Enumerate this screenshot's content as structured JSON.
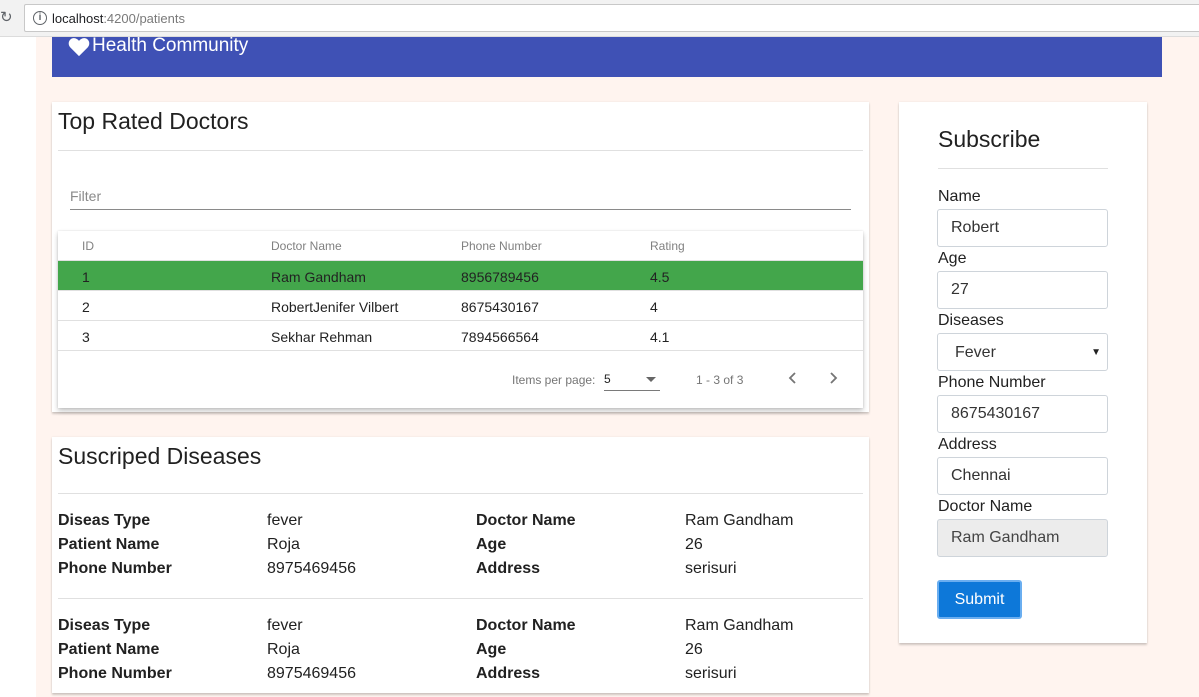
{
  "browser": {
    "url_host": "localhost",
    "url_rest": ":4200/patients"
  },
  "app": {
    "title": "Health Community",
    "brand_color": "#3f51b5",
    "icon": "heart-icon"
  },
  "doctors": {
    "title": "Top Rated Doctors",
    "filter_placeholder": "Filter",
    "columns": {
      "id": "ID",
      "name": "Doctor Name",
      "phone": "Phone Number",
      "rating": "Rating"
    },
    "rows": [
      {
        "id": "1",
        "name": "Ram Gandham",
        "phone": "8956789456",
        "rating": "4.5",
        "selected": true
      },
      {
        "id": "2",
        "name": "RobertJenifer Vilbert",
        "phone": "8675430167",
        "rating": "4",
        "selected": false
      },
      {
        "id": "3",
        "name": "Sekhar Rehman",
        "phone": "7894566564",
        "rating": "4.1",
        "selected": false
      }
    ],
    "selected_row_color": "#43a64b",
    "paginator": {
      "items_label": "Items per page:",
      "page_size": "5",
      "range": "1 - 3 of 3",
      "prev_icon": "chevron-left-icon",
      "next_icon": "chevron-right-icon"
    }
  },
  "diseases": {
    "title": "Suscriped Diseases",
    "labels": {
      "type": "Diseas Type",
      "patient": "Patient Name",
      "phone": "Phone Number",
      "doctor": "Doctor Name",
      "age": "Age",
      "address": "Address"
    },
    "entries": [
      {
        "type": "fever",
        "patient": "Roja",
        "phone": "8975469456",
        "doctor": "Ram Gandham",
        "age": "26",
        "address": "serisuri"
      },
      {
        "type": "fever",
        "patient": "Roja",
        "phone": "8975469456",
        "doctor": "Ram Gandham",
        "age": "26",
        "address": "serisuri"
      }
    ]
  },
  "subscribe": {
    "title": "Subscribe",
    "fields": {
      "name_label": "Name",
      "name_value": "Robert",
      "age_label": "Age",
      "age_value": "27",
      "diseases_label": "Diseases",
      "diseases_value": "Fever",
      "phone_label": "Phone Number",
      "phone_value": "8675430167",
      "address_label": "Address",
      "address_value": "Chennai",
      "doctor_label": "Doctor Name",
      "doctor_value": "Ram Gandham"
    },
    "submit_label": "Submit",
    "submit_color": "#0d78d9"
  }
}
